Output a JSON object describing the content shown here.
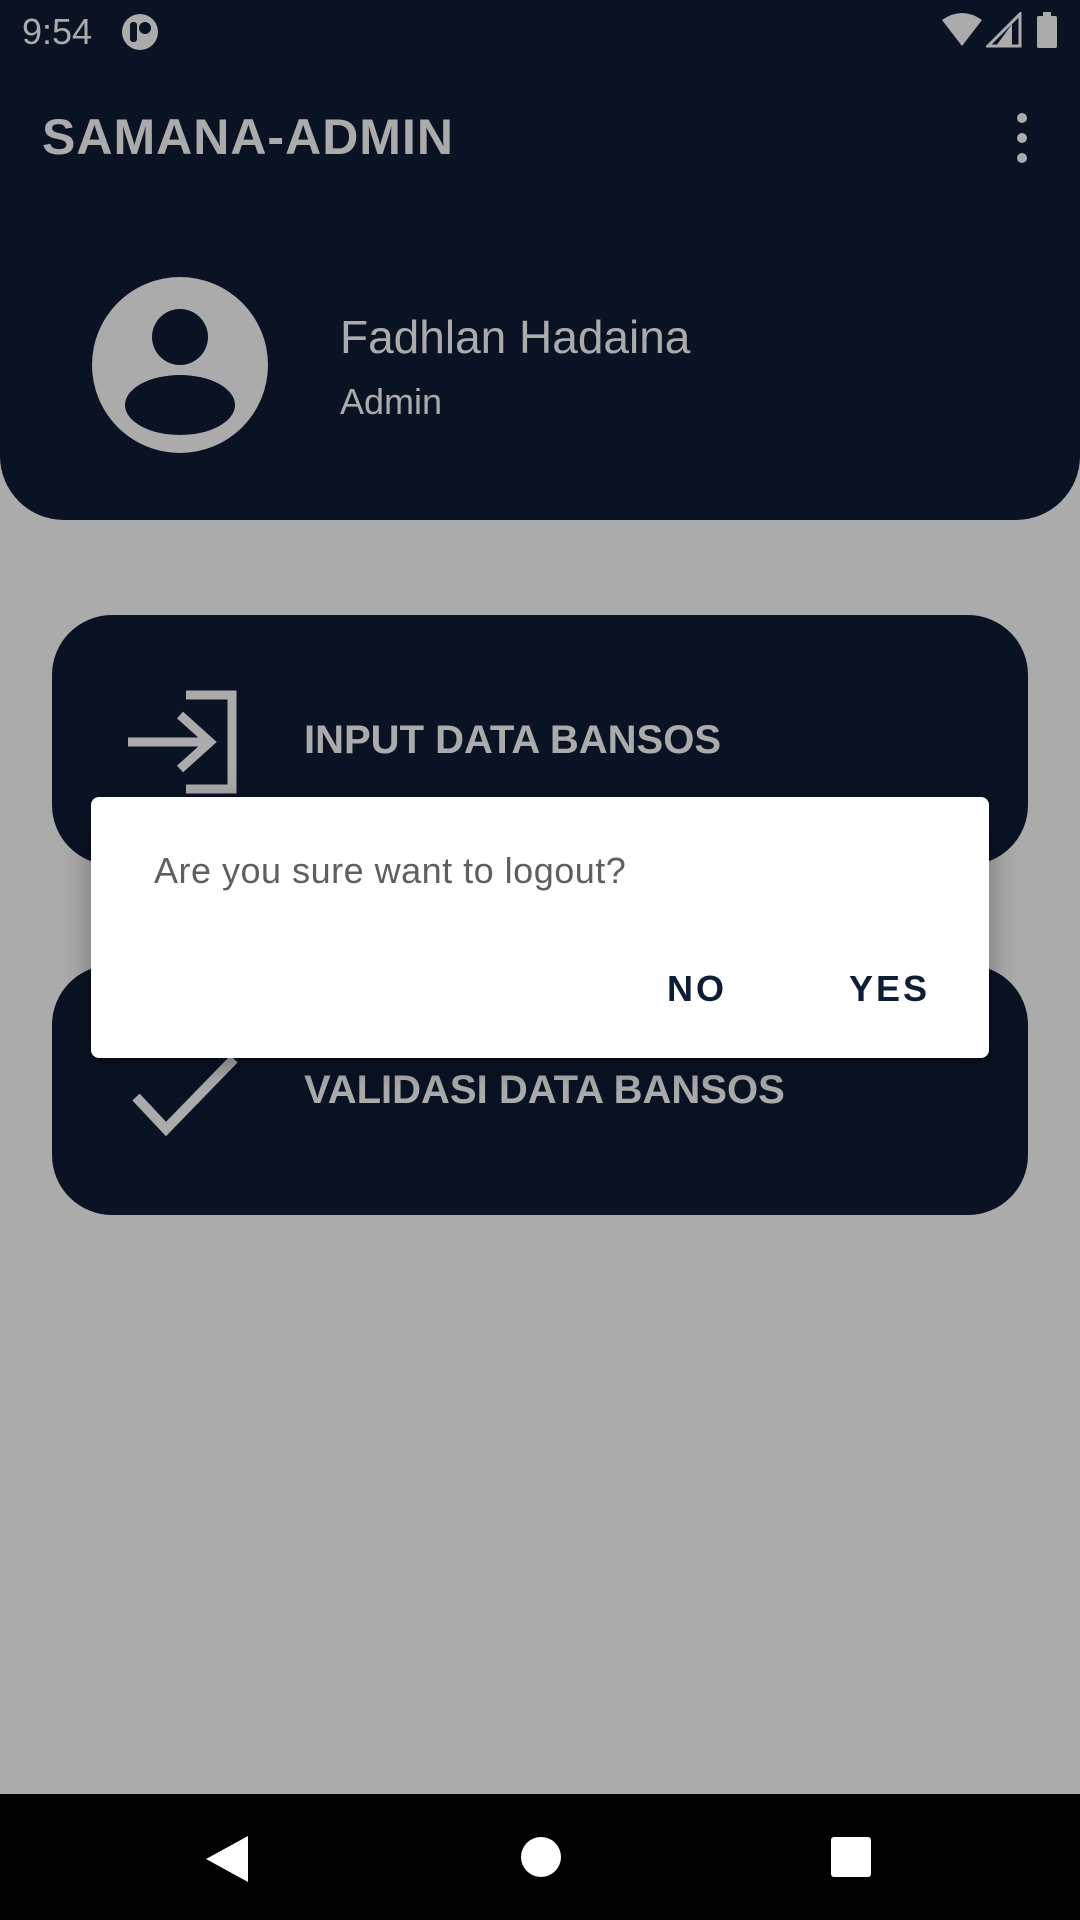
{
  "status_bar": {
    "time": "9:54",
    "icons": [
      "app-notification-icon",
      "wifi-icon",
      "cellular-signal-icon",
      "battery-icon"
    ]
  },
  "app_bar": {
    "title": "SAMANA-ADMIN",
    "menu_icon": "more-vert-icon"
  },
  "profile": {
    "name": "Fadhlan Hadaina",
    "role": "Admin",
    "avatar_icon": "account-circle-icon"
  },
  "menu": {
    "items": [
      {
        "label": "INPUT DATA BANSOS",
        "icon": "login-arrow-icon"
      },
      {
        "label": "VALIDASI DATA BANSOS",
        "icon": "check-icon"
      }
    ]
  },
  "dialog": {
    "message": "Are you sure want to logout?",
    "negative": "NO",
    "positive": "YES"
  },
  "nav_bar": {
    "icons": [
      "back-icon",
      "home-icon",
      "recents-icon"
    ]
  },
  "colors": {
    "primary": "#0e1d36",
    "scrim": "rgba(0,0,0,0.33)",
    "dialog_text": "#5f5f5f"
  }
}
